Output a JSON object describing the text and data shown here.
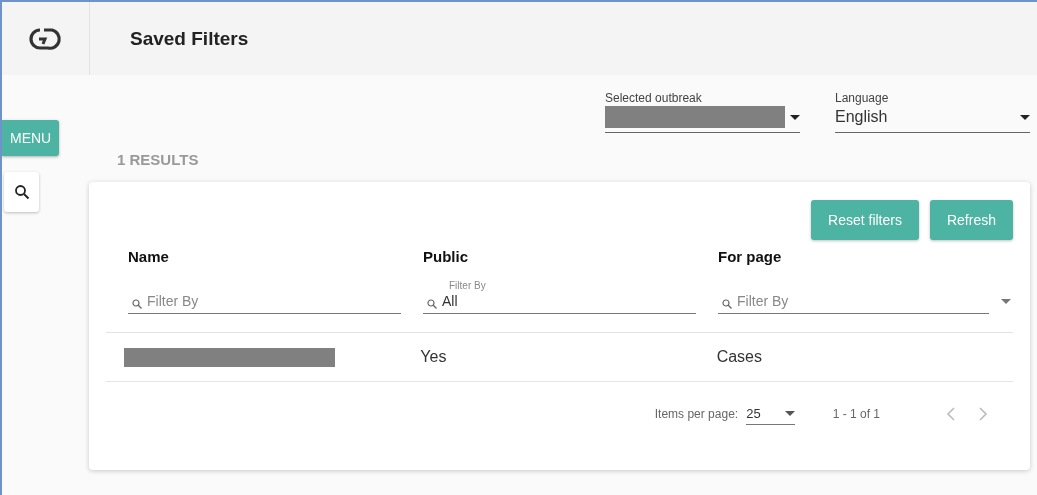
{
  "header": {
    "title": "Saved Filters"
  },
  "sidebar": {
    "menu_label": "MENU"
  },
  "selectors": [
    {
      "label": "Selected outbreak",
      "value_redacted": true
    },
    {
      "label": "Language",
      "value": "English"
    }
  ],
  "results_label": "1 RESULTS",
  "actions": [
    "Reset filters",
    "Refresh"
  ],
  "table": {
    "columns": [
      {
        "heading": "Name",
        "filter": {
          "placeholder": "Filter By"
        }
      },
      {
        "heading": "Public",
        "filter": {
          "label": "Filter By",
          "value": "All"
        }
      },
      {
        "heading": "For page",
        "filter": {
          "placeholder": "Filter By",
          "dropdown": true
        }
      }
    ],
    "rows": [
      {
        "cells": [
          {
            "redacted": true
          },
          {
            "text": "Yes"
          },
          {
            "text": "Cases"
          }
        ]
      }
    ]
  },
  "paginator": {
    "items_label": "Items per page:",
    "page_size": "25",
    "range": "1 - 1 of 1",
    "prev_disabled": true,
    "next_disabled": true
  }
}
